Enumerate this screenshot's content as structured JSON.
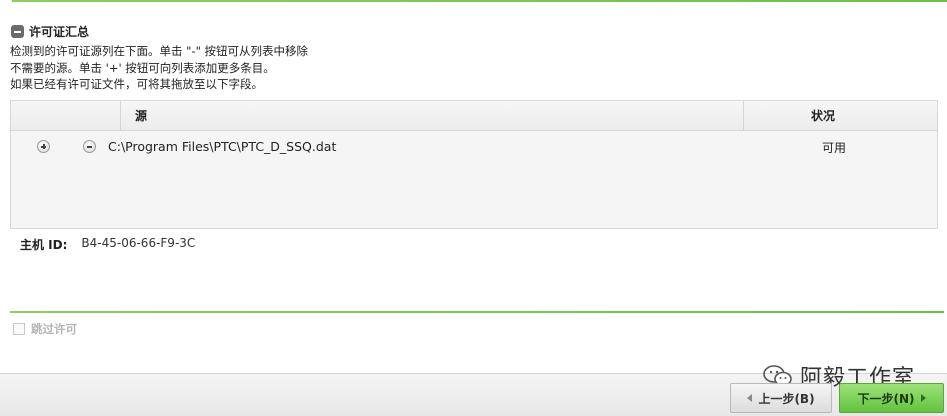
{
  "section": {
    "title": "许可证汇总",
    "description": [
      "检测到的许可证源列在下面。单击 \"-\" 按钮可从列表中移除",
      "不需要的源。单击 '+' 按钮可向列表添加更多条目。",
      "如果已经有许可证文件，可将其拖放至以下字段。"
    ]
  },
  "table": {
    "columns": {
      "source": "源",
      "status": "状况"
    },
    "rows": [
      {
        "add_icon": "plus-circle-icon",
        "remove_icon": "minus-circle-icon",
        "source": "C:\\Program Files\\PTC\\PTC_D_SSQ.dat",
        "status": "可用"
      }
    ]
  },
  "host": {
    "label": "主机 ID:",
    "value": "B4-45-06-66-F9-3C"
  },
  "skip_license": {
    "label": "跳过许可",
    "checked": false,
    "enabled": false
  },
  "watermark": {
    "text": "阿毅工作室"
  },
  "buttons": {
    "prev": "上一步(B)",
    "next": "下一步(N)"
  },
  "colors": {
    "accent": "#6cc04a",
    "next_button": "#7ed35a"
  }
}
